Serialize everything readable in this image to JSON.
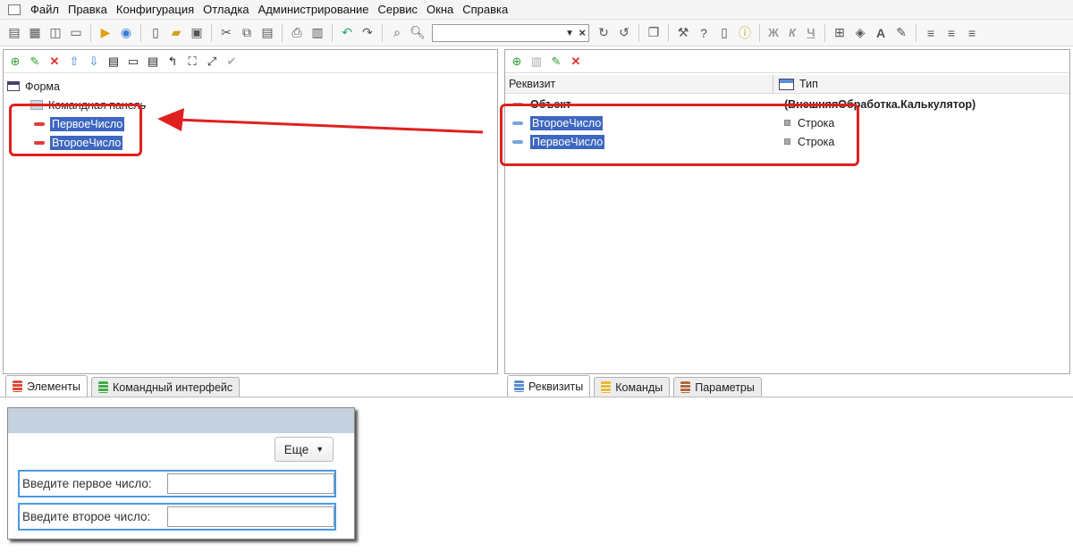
{
  "menu": [
    "Файл",
    "Правка",
    "Конфигурация",
    "Отладка",
    "Администрирование",
    "Сервис",
    "Окна",
    "Справка"
  ],
  "left_pane": {
    "root_label": "Форма",
    "command_panel_label": "Командная панель",
    "items": [
      {
        "label": "ПервоеЧисло"
      },
      {
        "label": "ВтороеЧисло"
      }
    ]
  },
  "right_pane": {
    "columns": [
      "Реквизит",
      "Тип"
    ],
    "rows": [
      {
        "name": "Объект",
        "type": "(ВнешняяОбработка.Калькулятор)"
      },
      {
        "name": "ВтороеЧисло",
        "type": "Строка"
      },
      {
        "name": "ПервоеЧисло",
        "type": "Строка"
      }
    ]
  },
  "left_tabs": [
    {
      "label": "Элементы",
      "color": "red"
    },
    {
      "label": "Командный интерфейс",
      "color": "green"
    }
  ],
  "right_tabs": [
    {
      "label": "Реквизиты",
      "color": "blue"
    },
    {
      "label": "Команды",
      "color": "yellow"
    },
    {
      "label": "Параметры",
      "color": "brown"
    }
  ],
  "preview": {
    "more_label": "Еще",
    "field1_label": "Введите первое число:",
    "field2_label": "Введите второе число:"
  },
  "colors": {
    "highlight": "#e02020",
    "selection": "#3d67c0"
  }
}
